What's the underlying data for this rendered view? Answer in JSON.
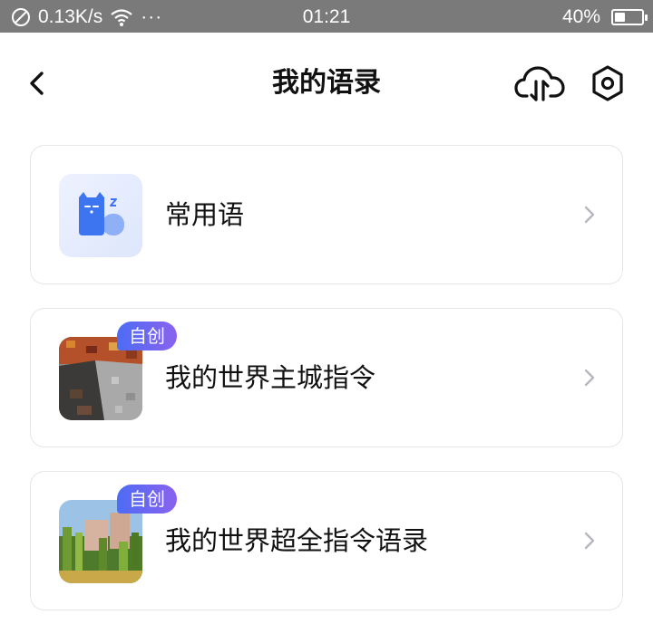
{
  "status_bar": {
    "network_speed": "0.13K/s",
    "more_dots": "···",
    "time": "01:21",
    "battery_percent": "40%",
    "battery_level": 0.4
  },
  "header": {
    "title": "我的语录"
  },
  "icons": {
    "back": "chevron-left-icon",
    "cloud": "cloud-sync-icon",
    "settings": "hexagon-settings-icon",
    "row_arrow": "chevron-right-icon"
  },
  "list": {
    "items": [
      {
        "label": "常用语",
        "thumbnail": "sleeping-cat-icon",
        "badge": ""
      },
      {
        "label": "我的世界主城指令",
        "thumbnail": "minecraft-block-image",
        "badge": "自创"
      },
      {
        "label": "我的世界超全指令语录",
        "thumbnail": "minecraft-landscape-image",
        "badge": "自创"
      }
    ]
  },
  "colors": {
    "status_bar_bg": "#7a7a7a",
    "badge_gradient_start": "#4d6cf5",
    "badge_gradient_end": "#8a62ee",
    "cat_icon_blue": "#3d74f0",
    "card_border": "#e6e6ea"
  }
}
